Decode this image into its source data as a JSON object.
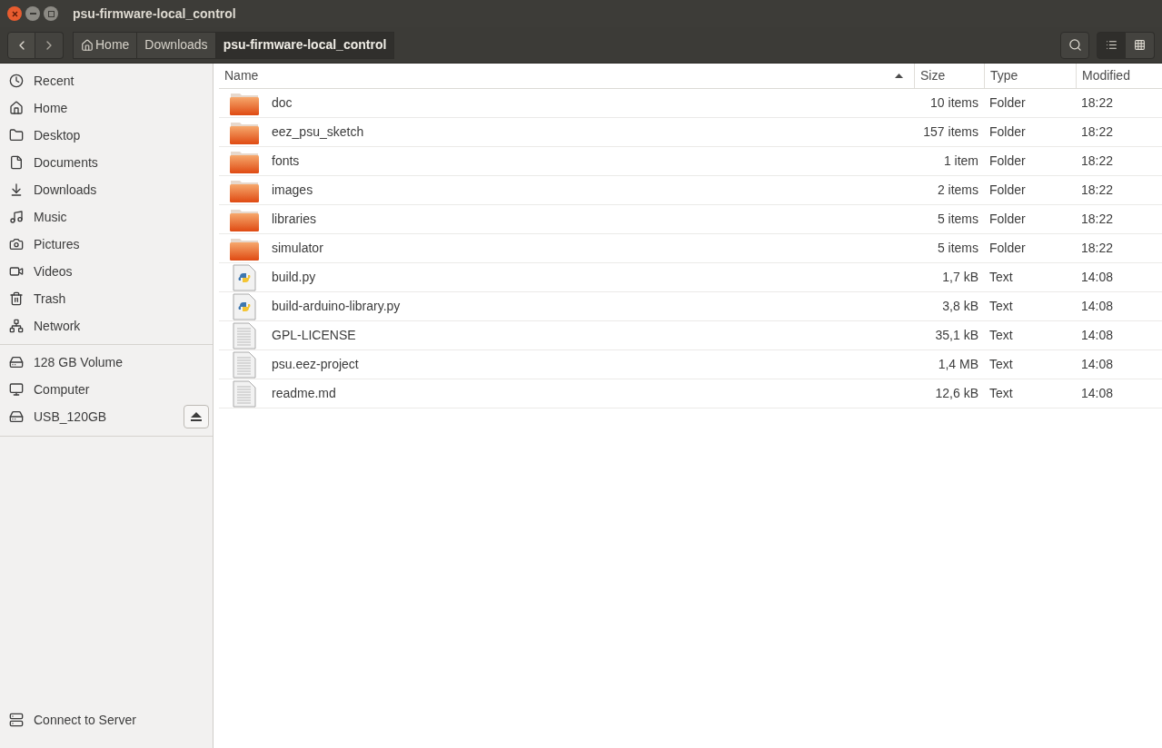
{
  "window": {
    "title": "psu-firmware-local_control"
  },
  "path_bar": [
    {
      "label": "Home",
      "selected": false
    },
    {
      "label": "Downloads",
      "selected": false
    },
    {
      "label": "psu-firmware-local_control",
      "selected": true
    }
  ],
  "view_buttons": [
    {
      "kind": "list",
      "selected": true
    },
    {
      "kind": "grid",
      "selected": false
    }
  ],
  "sidebar": {
    "places": [
      "Recent",
      "Home",
      "Desktop",
      "Documents",
      "Downloads",
      "Music",
      "Pictures",
      "Videos",
      "Trash",
      "Network"
    ],
    "devices": [
      {
        "label": "128 GB Volume",
        "ejectable": false
      },
      {
        "label": "Computer",
        "ejectable": false
      },
      {
        "label": "USB_120GB",
        "ejectable": true
      }
    ],
    "footer": "Connect to Server"
  },
  "table": {
    "columns": [
      {
        "label": "Name",
        "sorted": true
      },
      {
        "label": "Size",
        "sorted": false
      },
      {
        "label": "Type",
        "sorted": false
      },
      {
        "label": "Modified",
        "sorted": false
      }
    ],
    "rows": [
      {
        "name": "doc",
        "size": "10 items",
        "type": "Folder",
        "modified": "18:22",
        "kind": "folder"
      },
      {
        "name": "eez_psu_sketch",
        "size": "157 items",
        "type": "Folder",
        "modified": "18:22",
        "kind": "folder"
      },
      {
        "name": "fonts",
        "size": "1 item",
        "type": "Folder",
        "modified": "18:22",
        "kind": "folder"
      },
      {
        "name": "images",
        "size": "2 items",
        "type": "Folder",
        "modified": "18:22",
        "kind": "folder"
      },
      {
        "name": "libraries",
        "size": "5 items",
        "type": "Folder",
        "modified": "18:22",
        "kind": "folder"
      },
      {
        "name": "simulator",
        "size": "5 items",
        "type": "Folder",
        "modified": "18:22",
        "kind": "folder"
      },
      {
        "name": "build.py",
        "size": "1,7 kB",
        "type": "Text",
        "modified": "14:08",
        "kind": "python"
      },
      {
        "name": "build-arduino-library.py",
        "size": "3,8 kB",
        "type": "Text",
        "modified": "14:08",
        "kind": "python"
      },
      {
        "name": "GPL-LICENSE",
        "size": "35,1 kB",
        "type": "Text",
        "modified": "14:08",
        "kind": "text"
      },
      {
        "name": "psu.eez-project",
        "size": "1,4 MB",
        "type": "Text",
        "modified": "14:08",
        "kind": "text"
      },
      {
        "name": "readme.md",
        "size": "12,6 kB",
        "type": "Text",
        "modified": "14:08",
        "kind": "text"
      }
    ]
  }
}
